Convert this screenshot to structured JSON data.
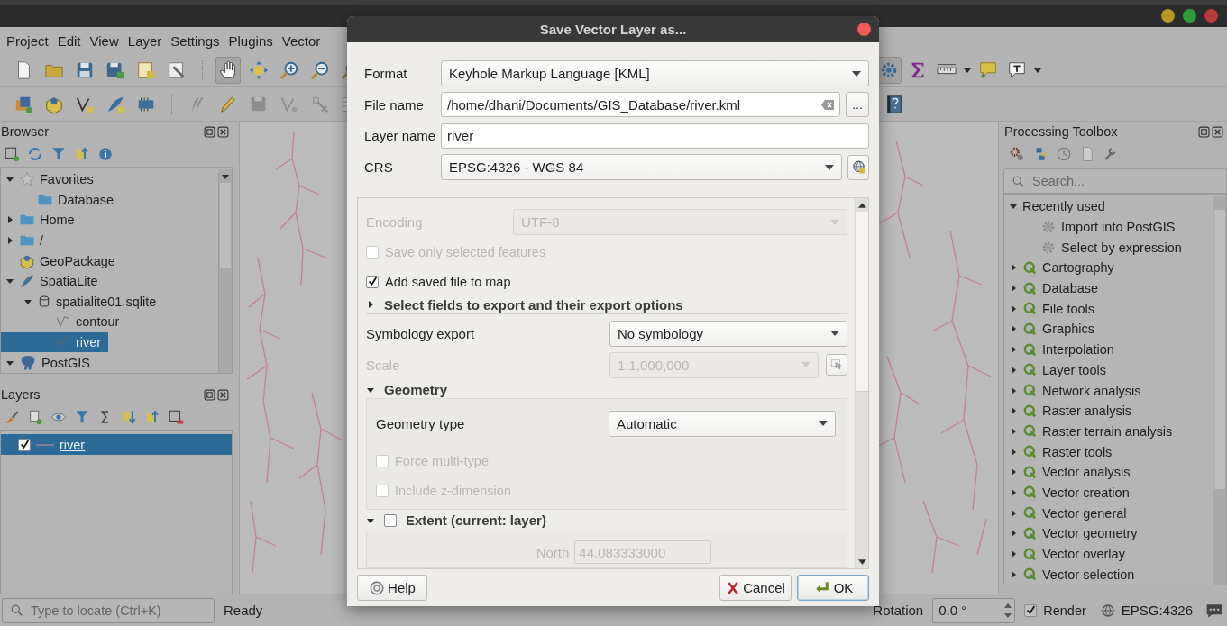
{
  "menu": [
    "Project",
    "Edit",
    "View",
    "Layer",
    "Settings",
    "Plugins",
    "Vector"
  ],
  "toolbar": {
    "pan_selected": true,
    "toolbox_selected": true
  },
  "browser": {
    "title": "Browser",
    "items": [
      {
        "label": "Favorites",
        "kind": "favorites",
        "expanded": true,
        "selected": false,
        "children": [
          {
            "label": "Database",
            "kind": "folder",
            "selected": false
          }
        ]
      },
      {
        "label": "Home",
        "kind": "folder",
        "expanded": false,
        "selected": false
      },
      {
        "label": "/",
        "kind": "folder",
        "expanded": false,
        "selected": false
      },
      {
        "label": "GeoPackage",
        "kind": "geopackage",
        "selected": false
      },
      {
        "label": "SpatiaLite",
        "kind": "spatialite",
        "expanded": true,
        "selected": false,
        "children": [
          {
            "label": "spatialite01.sqlite",
            "kind": "sqlite",
            "expanded": true,
            "selected": false,
            "children": [
              {
                "label": "contour",
                "kind": "line_layer",
                "selected": false
              },
              {
                "label": "river",
                "kind": "line_layer",
                "selected": true
              }
            ]
          }
        ]
      },
      {
        "label": "PostGIS",
        "kind": "postgis",
        "expanded": true,
        "selected": false
      }
    ]
  },
  "layers": {
    "title": "Layers",
    "items": [
      {
        "label": "river",
        "checked": true,
        "selected": true
      }
    ]
  },
  "locator": {
    "placeholder": "Type to locate (Ctrl+K)"
  },
  "status": {
    "message": "Ready",
    "rotation_label": "Rotation",
    "rotation": "0.0 °",
    "render": {
      "label": "Render",
      "checked": true
    },
    "crs": "EPSG:4326"
  },
  "toolbox": {
    "title": "Processing Toolbox",
    "search_placeholder": "Search...",
    "items": [
      {
        "label": "Recently used",
        "kind": "group",
        "expanded": true,
        "children": [
          {
            "label": "Import into PostGIS",
            "kind": "algorithm"
          },
          {
            "label": "Select by expression",
            "kind": "algorithm"
          }
        ]
      },
      {
        "label": "Cartography",
        "kind": "provider",
        "expanded": false
      },
      {
        "label": "Database",
        "kind": "provider",
        "expanded": false
      },
      {
        "label": "File tools",
        "kind": "provider",
        "expanded": false
      },
      {
        "label": "Graphics",
        "kind": "provider",
        "expanded": false
      },
      {
        "label": "Interpolation",
        "kind": "provider",
        "expanded": false
      },
      {
        "label": "Layer tools",
        "kind": "provider",
        "expanded": false
      },
      {
        "label": "Network analysis",
        "kind": "provider",
        "expanded": false
      },
      {
        "label": "Raster analysis",
        "kind": "provider",
        "expanded": false
      },
      {
        "label": "Raster terrain analysis",
        "kind": "provider",
        "expanded": false
      },
      {
        "label": "Raster tools",
        "kind": "provider",
        "expanded": false
      },
      {
        "label": "Vector analysis",
        "kind": "provider",
        "expanded": false
      },
      {
        "label": "Vector creation",
        "kind": "provider",
        "expanded": false
      },
      {
        "label": "Vector general",
        "kind": "provider",
        "expanded": false
      },
      {
        "label": "Vector geometry",
        "kind": "provider",
        "expanded": false
      },
      {
        "label": "Vector overlay",
        "kind": "provider",
        "expanded": false
      },
      {
        "label": "Vector selection",
        "kind": "provider",
        "expanded": false
      }
    ]
  },
  "dialog": {
    "title": "Save Vector Layer as...",
    "format": {
      "label": "Format",
      "value": "Keyhole Markup Language [KML]"
    },
    "file_name": {
      "label": "File name",
      "value": "/home/dhani/Documents/GIS_Database/river.kml",
      "browse": "..."
    },
    "layer_name": {
      "label": "Layer name",
      "value": "river"
    },
    "crs": {
      "label": "CRS",
      "value": "EPSG:4326 - WGS 84"
    },
    "encoding": {
      "label": "Encoding",
      "value": "UTF-8",
      "disabled": true
    },
    "options": [
      {
        "label": "Save only selected features",
        "checked": false,
        "disabled": true
      },
      {
        "label": "Add saved file to map",
        "checked": true,
        "disabled": false
      }
    ],
    "fields_section": {
      "label": "Select fields to export and their export options",
      "expanded": false
    },
    "symbology": {
      "label": "Symbology export",
      "value": "No symbology"
    },
    "scale": {
      "label": "Scale",
      "value": "1:1,000,000",
      "disabled": true
    },
    "geometry": {
      "label": "Geometry",
      "expanded": true,
      "type": {
        "label": "Geometry type",
        "value": "Automatic"
      },
      "options": [
        {
          "label": "Force multi-type",
          "checked": false,
          "disabled": true
        },
        {
          "label": "Include z-dimension",
          "checked": false,
          "disabled": true
        }
      ]
    },
    "extent": {
      "label": "Extent (current: layer)",
      "expanded": true,
      "checked": false,
      "north": {
        "label": "North",
        "value": "44.083333000",
        "disabled": true
      }
    },
    "buttons": [
      {
        "label": "Help",
        "kind": "help"
      },
      {
        "label": "Cancel",
        "kind": "cancel"
      },
      {
        "label": "OK",
        "kind": "ok"
      }
    ]
  }
}
